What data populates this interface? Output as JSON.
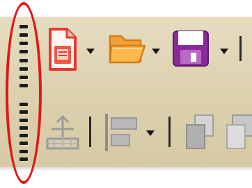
{
  "toolbar": {
    "row1": {
      "buttons": [
        {
          "id": "new",
          "icon": "new-document-icon"
        },
        {
          "id": "open",
          "icon": "open-folder-icon"
        },
        {
          "id": "save",
          "icon": "save-disk-icon"
        }
      ]
    },
    "row2": {
      "buttons": [
        {
          "id": "anchor",
          "icon": "anchor-icon",
          "disabled": true
        },
        {
          "id": "align",
          "icon": "align-objects-icon",
          "disabled": true
        },
        {
          "id": "arrange-front",
          "icon": "bring-to-front-icon",
          "disabled": true
        },
        {
          "id": "arrange-back",
          "icon": "send-to-back-icon",
          "disabled": true
        }
      ]
    },
    "grip_handles": 2,
    "annotation": {
      "shape": "ellipse",
      "color": "#e01818",
      "target": "toolbar-grip-handles"
    }
  },
  "colors": {
    "toolbar_bg": "#ddd2b2",
    "new_doc_red": "#e8382e",
    "folder_orange": "#f59a2e",
    "disk_purple": "#8a2a9a",
    "disabled_gray": "#9a9a9a",
    "highlight_red": "#e01818"
  }
}
